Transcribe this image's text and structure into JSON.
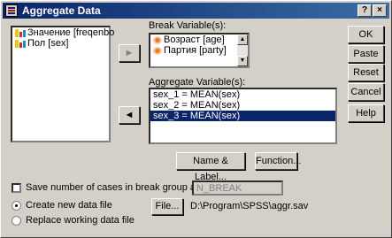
{
  "window": {
    "title": "Aggregate Data",
    "help_glyph": "?",
    "close_glyph": "×"
  },
  "source_vars": {
    "items": [
      "Значение [freqenbo",
      "Пол [sex]"
    ]
  },
  "break": {
    "label": "Break Variable(s):",
    "items": [
      "Возраст [age]",
      "Партия [party]"
    ]
  },
  "aggregate": {
    "label": "Aggregate Variable(s):",
    "items": [
      "sex_1 = MEAN(sex)",
      "sex_2 = MEAN(sex)",
      "sex_3 = MEAN(sex)"
    ],
    "selected_index": 2
  },
  "buttons": {
    "ok": "OK",
    "paste": "Paste",
    "reset": "Reset",
    "cancel": "Cancel",
    "help": "Help",
    "name_label": "Name & Label...",
    "function": "Function...",
    "file": "File...",
    "move_right": "►",
    "move_left": "◄"
  },
  "options": {
    "save_cases_label": "Save number of cases in break group as variable:",
    "save_cases_checked": false,
    "break_var_name": "N_BREAK",
    "create_new_file_label": "Create new data file",
    "replace_file_label": "Replace working data file",
    "selected": "create_new",
    "file_path": "D:\\Program\\SPSS\\aggr.sav"
  },
  "colors": {
    "selection": "#0a246a",
    "titlebar": "#0a246a",
    "face": "#d4d0c8"
  }
}
